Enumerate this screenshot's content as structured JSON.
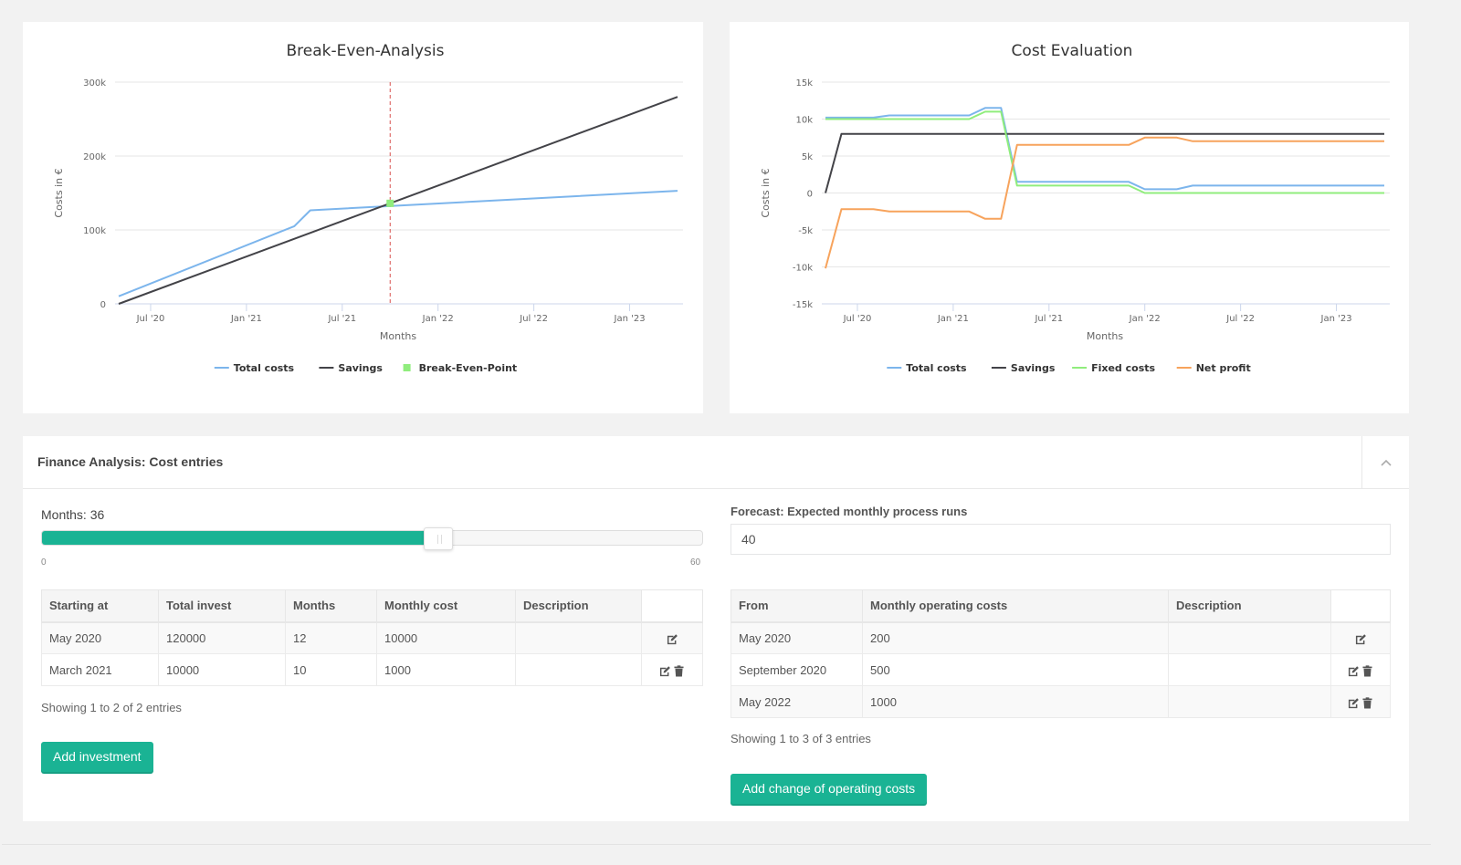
{
  "break_even_chart": {
    "legend": {
      "total_costs": "Total costs",
      "savings": "Savings",
      "break_even_point": "Break-Even-Point"
    }
  },
  "cost_eval_chart": {
    "legend": {
      "total_costs": "Total costs",
      "savings": "Savings",
      "fixed_costs": "Fixed costs",
      "net_profit": "Net profit"
    }
  },
  "colors": {
    "total_costs": "#7cb5ec",
    "savings": "#434348",
    "fixed_costs": "#90ed7d",
    "net_profit": "#f7a35c",
    "break_even_line": "#d9534f",
    "accent": "#1ab394"
  },
  "chart_data": [
    {
      "type": "line",
      "title": "Break-Even-Analysis",
      "xlabel": "Months",
      "ylabel": "Costs in €",
      "x_start": "2020-05",
      "x_end": "2023-04",
      "x_ticks": [
        "Jul '20",
        "Jan '21",
        "Jul '21",
        "Jan '22",
        "Jul '22",
        "Jan '23"
      ],
      "x_tick_months": [
        2,
        8,
        14,
        20,
        26,
        32
      ],
      "y_ticks": [
        "0",
        "100k",
        "200k",
        "300k"
      ],
      "y_tick_values": [
        0,
        100000,
        200000,
        300000
      ],
      "ylim": [
        0,
        300000
      ],
      "grid": true,
      "legend_position": "bottom",
      "series": [
        {
          "name": "Total costs",
          "key": "total_costs",
          "points": [
            [
              0,
              10200
            ],
            [
              11,
              105000
            ],
            [
              12,
              126500
            ],
            [
              35,
              153000
            ]
          ]
        },
        {
          "name": "Savings",
          "key": "savings",
          "points": [
            [
              0,
              0
            ],
            [
              35,
              280000
            ]
          ]
        }
      ],
      "break_even_point": {
        "month": 17,
        "value": 136000,
        "label": "Break-Even-Point"
      }
    },
    {
      "type": "line",
      "title": "Cost Evaluation",
      "xlabel": "Months",
      "ylabel": "Costs in €",
      "x_start": "2020-05",
      "x_end": "2023-04",
      "x_ticks": [
        "Jul '20",
        "Jan '21",
        "Jul '21",
        "Jan '22",
        "Jul '22",
        "Jan '23"
      ],
      "x_tick_months": [
        2,
        8,
        14,
        20,
        26,
        32
      ],
      "y_ticks": [
        "-15k",
        "-10k",
        "-5k",
        "0",
        "5k",
        "10k",
        "15k"
      ],
      "y_tick_values": [
        -15000,
        -10000,
        -5000,
        0,
        5000,
        10000,
        15000
      ],
      "ylim": [
        -15000,
        15000
      ],
      "grid": true,
      "legend_position": "bottom",
      "series": [
        {
          "name": "Total costs",
          "key": "total_costs",
          "points": [
            [
              0,
              10200
            ],
            [
              3,
              10200
            ],
            [
              4,
              10500
            ],
            [
              9,
              10500
            ],
            [
              10,
              11500
            ],
            [
              11,
              11500
            ],
            [
              12,
              1500
            ],
            [
              19,
              1500
            ],
            [
              20,
              500
            ],
            [
              22,
              500
            ],
            [
              23,
              1000
            ],
            [
              35,
              1000
            ]
          ]
        },
        {
          "name": "Savings",
          "key": "savings",
          "points": [
            [
              0,
              0
            ],
            [
              1,
              8000
            ],
            [
              35,
              8000
            ]
          ]
        },
        {
          "name": "Fixed costs",
          "key": "fixed_costs",
          "points": [
            [
              0,
              10000
            ],
            [
              9,
              10000
            ],
            [
              10,
              11000
            ],
            [
              11,
              11000
            ],
            [
              12,
              1000
            ],
            [
              19,
              1000
            ],
            [
              20,
              0
            ],
            [
              35,
              0
            ]
          ]
        },
        {
          "name": "Net profit",
          "key": "net_profit",
          "points": [
            [
              0,
              -10200
            ],
            [
              1,
              -2200
            ],
            [
              3,
              -2200
            ],
            [
              4,
              -2500
            ],
            [
              9,
              -2500
            ],
            [
              10,
              -3500
            ],
            [
              11,
              -3500
            ],
            [
              12,
              6500
            ],
            [
              19,
              6500
            ],
            [
              20,
              7500
            ],
            [
              22,
              7500
            ],
            [
              23,
              7000
            ],
            [
              35,
              7000
            ]
          ]
        }
      ]
    }
  ],
  "panel": {
    "title": "Finance Analysis: Cost entries",
    "collapse_icon": "chevron-up-icon"
  },
  "slider": {
    "label": "Months: 36",
    "value": 36,
    "min": 0,
    "max": 60,
    "min_label": "0",
    "max_label": "60"
  },
  "forecast": {
    "label": "Forecast: Expected monthly process runs",
    "value": "40"
  },
  "investments": {
    "columns": [
      "Starting at",
      "Total invest",
      "Months",
      "Monthly cost",
      "Description",
      ""
    ],
    "rows": [
      {
        "starting_at": "May 2020",
        "total_invest": "120000",
        "months": "12",
        "monthly_cost": "10000",
        "description": "",
        "actions": [
          "edit"
        ]
      },
      {
        "starting_at": "March 2021",
        "total_invest": "10000",
        "months": "10",
        "monthly_cost": "1000",
        "description": "",
        "actions": [
          "edit",
          "delete"
        ]
      }
    ],
    "info": "Showing 1 to 2 of 2 entries",
    "add_button": "Add investment"
  },
  "operating_costs": {
    "columns": [
      "From",
      "Monthly operating costs",
      "Description",
      ""
    ],
    "rows": [
      {
        "from": "May 2020",
        "monthly_operating_costs": "200",
        "description": "",
        "actions": [
          "edit"
        ]
      },
      {
        "from": "September 2020",
        "monthly_operating_costs": "500",
        "description": "",
        "actions": [
          "edit",
          "delete"
        ]
      },
      {
        "from": "May 2022",
        "monthly_operating_costs": "1000",
        "description": "",
        "actions": [
          "edit",
          "delete"
        ]
      }
    ],
    "info": "Showing 1 to 3 of 3 entries",
    "add_button": "Add change of operating costs"
  }
}
